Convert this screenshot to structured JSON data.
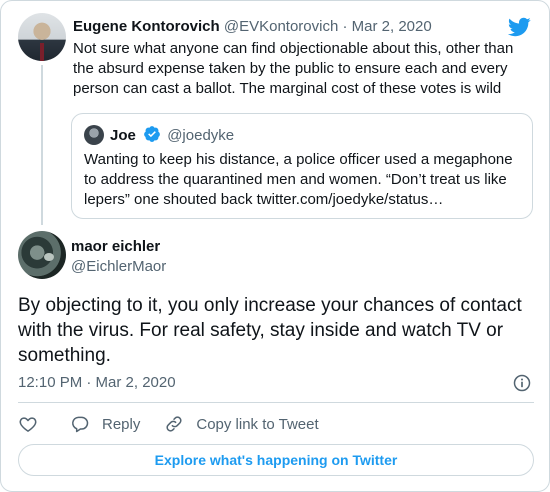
{
  "parent_tweet": {
    "author_name": "Eugene Kontorovich",
    "handle": "@EVKontorovich",
    "separator": "·",
    "date": "Mar 2, 2020",
    "text": "Not sure what anyone can find objectionable about this, other than the absurd expense taken by the public to ensure each and every person can cast a ballot. The marginal cost of these votes is wild"
  },
  "quoted_tweet": {
    "author_name": "Joe",
    "handle": "@joedyke",
    "text": "Wanting to keep his distance, a police officer used a megaphone to address the quarantined men and women. “Don’t treat us like lepers” one shouted back twitter.com/joedyke/status…"
  },
  "main_tweet": {
    "author_name": "maor eichler",
    "handle": "@EichlerMaor",
    "text": "By objecting to it, you only increase your chances of contact with the virus. For real safety, stay inside and watch TV or something.",
    "timestamp": "12:10 PM · Mar 2, 2020"
  },
  "actions": {
    "reply_label": "Reply",
    "copy_link_label": "Copy link to Tweet"
  },
  "explore_button_label": "Explore what's happening on Twitter",
  "icons": {
    "brand": "twitter-bird-icon",
    "verified": "verified-badge-icon",
    "info": "info-icon",
    "like": "heart-icon",
    "reply": "reply-bubble-icon",
    "copy_link": "link-icon"
  },
  "colors": {
    "twitter_blue": "#1d9bf0",
    "text_primary": "#0f1419",
    "text_secondary": "#536471",
    "border": "#cfd9de"
  }
}
